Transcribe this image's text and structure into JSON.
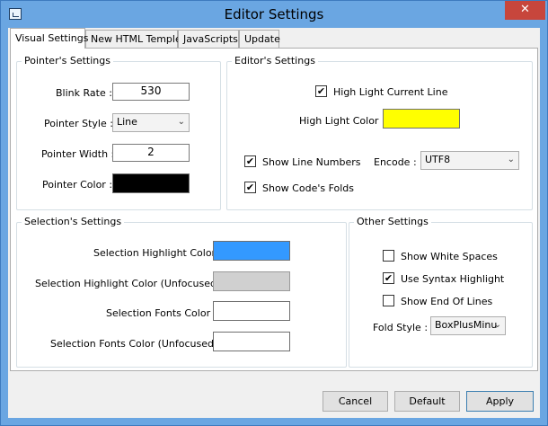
{
  "window": {
    "title": "Editor Settings",
    "close_glyph": "✕"
  },
  "tabs": [
    {
      "label": "Visual Settings"
    },
    {
      "label": "New HTML Temple"
    },
    {
      "label": "JavaScripts"
    },
    {
      "label": "Update"
    }
  ],
  "pointer": {
    "group_title": "Pointer's Settings",
    "blink_rate_label": "Blink Rate  :",
    "blink_rate_value": "530",
    "style_label": "Pointer Style  :",
    "style_value": "Line",
    "width_label": "Pointer Width  :",
    "width_value": "2",
    "color_label": "Pointer Color  :",
    "color": "#000000"
  },
  "editor": {
    "group_title": "Editor's Settings",
    "highlight_line_label": "High Light Current Line",
    "highlight_line_checked": true,
    "highlight_color_label": "High Light Color  :",
    "highlight_color": "#ffff00",
    "show_line_numbers_label": "Show Line Numbers",
    "show_line_numbers_checked": true,
    "show_folds_label": "Show Code's Folds",
    "show_folds_checked": true,
    "encode_label": "Encode  :",
    "encode_value": "UTF8"
  },
  "selection": {
    "group_title": "Selection's Settings",
    "highlight_color_label": "Selection Highlight Color  :",
    "highlight_color": "#3399ff",
    "highlight_unfocused_label": "Selection Highlight Color (Unfocused)  :",
    "highlight_unfocused_color": "#d0d0d0",
    "fonts_color_label": "Selection Fonts Color  :",
    "fonts_color": "#ffffff",
    "fonts_unfocused_label": "Selection Fonts Color (Unfocused):",
    "fonts_unfocused_color": "#ffffff"
  },
  "other": {
    "group_title": "Other Settings",
    "show_white_spaces_label": "Show White Spaces",
    "show_white_spaces_checked": false,
    "syntax_highlight_label": "Use Syntax Highlight",
    "syntax_highlight_checked": true,
    "show_eol_label": "Show End Of Lines",
    "show_eol_checked": false,
    "fold_style_label": "Fold Style  :",
    "fold_style_value": "BoxPlusMinu"
  },
  "buttons": {
    "cancel": "Cancel",
    "default": "Default",
    "apply": "Apply"
  },
  "glyphs": {
    "check": "✔",
    "dropdown": "⌄"
  }
}
